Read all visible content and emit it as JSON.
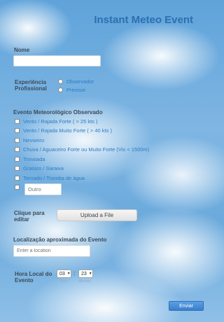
{
  "title": "Instant Meteo Event",
  "name": {
    "label": "Nome",
    "value": ""
  },
  "experience": {
    "label_line1": "Experiência",
    "label_line2": "Profissional",
    "options": [
      "Observador",
      "Previsor"
    ]
  },
  "event": {
    "label": "Evento Meteorológico Observado",
    "options": [
      "Vento / Rajada Forte ( > 25 kts )",
      "Vento / Rajada Muito Forte ( > 40 kts )",
      "Nevoeiro",
      "Chuva / Aguaceiro Forte ou Muito Forte (Vis < 1500m)",
      "Trovoada",
      "Granizo / Saraiva",
      "Tornado / Tromba de água"
    ],
    "other_placeholder": "Outro"
  },
  "upload": {
    "label_line1": "Clique para",
    "label_line2": "editar",
    "button": "Upload a File"
  },
  "location": {
    "label": "Localização aproximada do Evento",
    "placeholder": "Enter a location"
  },
  "time": {
    "label_line1": "Hora Local do",
    "label_line2": "Evento",
    "hour": "03",
    "minute": "23",
    "separator": ":",
    "hour_caption": "Hora",
    "minute_caption": "Minutos"
  },
  "submit": "Enviar",
  "colors": {
    "title": "#2d6fb0",
    "option_text": "#2e7dc4",
    "submit": "#3a7fcb"
  }
}
